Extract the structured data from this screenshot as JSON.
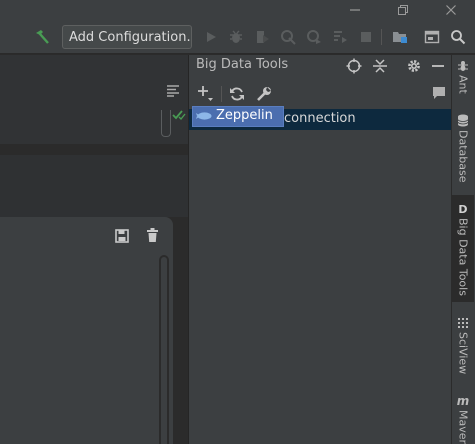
{
  "toolbar": {
    "run_configuration_label": "Add Configuration..."
  },
  "big_data_tools": {
    "title": "Big Data Tools",
    "connection_label": "connection",
    "add_menu": {
      "items": [
        {
          "label": "Zeppelin",
          "icon": "zeppelin-icon"
        }
      ]
    }
  },
  "right_stripe": {
    "tabs": [
      {
        "label": "Ant",
        "icon": "ant-icon"
      },
      {
        "label": "Database",
        "icon": "database-icon"
      },
      {
        "label": "Big Data Tools",
        "icon": "big-data-tools-icon",
        "glyph": "D",
        "active": true
      },
      {
        "label": "SciView",
        "icon": "sciview-icon"
      },
      {
        "label": "Maven",
        "icon": "maven-icon",
        "glyph": "m"
      }
    ]
  },
  "colors": {
    "accent_selection": "#4b6eaf",
    "build_hammer": "#499c54",
    "selected_row": "#0d293e"
  }
}
